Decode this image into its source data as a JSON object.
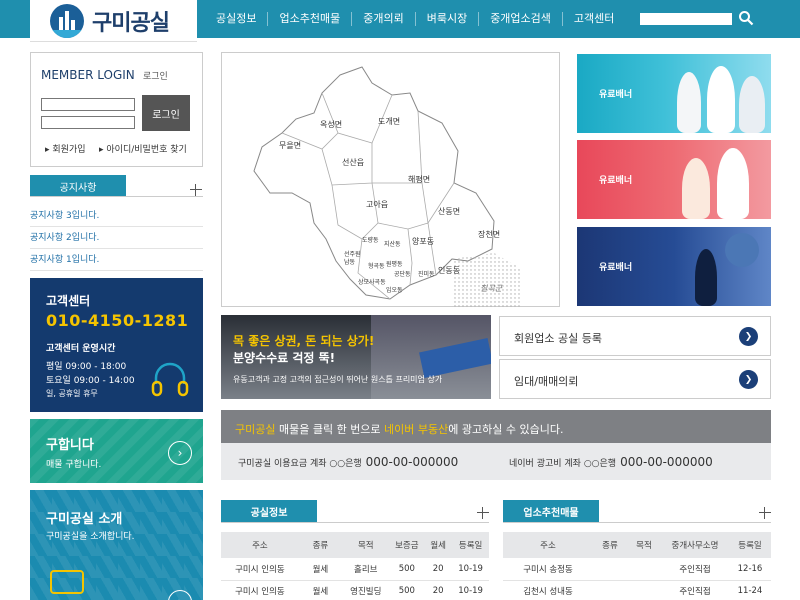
{
  "header": {
    "logo_text": "구미공실",
    "nav": [
      "공실정보",
      "업소추천매물",
      "중개의뢰",
      "벼룩시장",
      "중개업소검색",
      "고객센터"
    ]
  },
  "login": {
    "title": "MEMBER LOGIN",
    "subtitle": "로그인",
    "button": "로그인",
    "join": "회원가입",
    "find": "아이디/비밀번호 찾기"
  },
  "notice": {
    "title": "공지사항",
    "items": [
      "공지사항 3입니다.",
      "공지사항 2입니다.",
      "공지사항 1입니다."
    ]
  },
  "customer_center": {
    "title": "고객센터",
    "phone": "010-4150-1281",
    "hours_title": "고객센터 운영시간",
    "weekday": "평일 09:00 - 18:00",
    "saturday": "토요일 09:00 - 14:00",
    "holiday": "일, 공휴일 휴무"
  },
  "find_box": {
    "title": "구합니다",
    "subtitle": "매물 구합니다."
  },
  "intro_box": {
    "title": "구미공실 소개",
    "subtitle": "구미공실을 소개합니다."
  },
  "map": {
    "labels": [
      "옥성면",
      "도개면",
      "무을면",
      "선산읍",
      "해평면",
      "고아읍",
      "산동면",
      "장천면",
      "도량동",
      "지산동",
      "양포동",
      "선주원남동",
      "형곡동",
      "공단동",
      "진미동",
      "인동동",
      "상모사곡동",
      "임오동",
      "원평동",
      "칠곡군"
    ]
  },
  "banners": [
    {
      "label": "유료배너",
      "color": "#1fa4c8"
    },
    {
      "label": "유료배너",
      "color": "#e8505b"
    },
    {
      "label": "유료배너",
      "color": "#1c3f7e"
    }
  ],
  "promo": {
    "title": "목 좋은 상권, 돈 되는 상가!",
    "title2": "분양수수료 걱정 뚝!",
    "subtitle": "유동고객과 고정 고객의 접근성이 뛰어난 원스톱 프리미엄 상가"
  },
  "actions": [
    "회원업소 공실 등록",
    "임대/매매의뢰"
  ],
  "ad": {
    "headline_pre": "구미공실",
    "headline_mid": " 매물을 클릭 한 번으로 ",
    "headline_hl": "네이버 부동산",
    "headline_post": "에 광고하실 수 있습니다.",
    "acct1_label": "구미공실 이용요금 계좌  ○○은행",
    "acct1_num": "000-00-000000",
    "acct2_label": "네이버 광고비 계좌  ○○은행",
    "acct2_num": "000-00-000000"
  },
  "vacancy_table": {
    "title": "공실정보",
    "headers": [
      "주소",
      "종류",
      "목적",
      "보증금",
      "월세",
      "등록일"
    ],
    "rows": [
      [
        "구미시 인의동",
        "월세",
        "홀리브",
        "500",
        "20",
        "10-19"
      ],
      [
        "구미시 인의동",
        "월세",
        "영진빌딩",
        "500",
        "20",
        "10-19"
      ]
    ]
  },
  "recommend_table": {
    "title": "업소추천매물",
    "headers": [
      "주소",
      "종류",
      "목적",
      "중개사무소명",
      "등록일"
    ],
    "rows": [
      [
        "구미시 송정동",
        "",
        "",
        "주인직접",
        "12-16"
      ],
      [
        "김천시 성내동",
        "",
        "",
        "주인직접",
        "11-24"
      ]
    ]
  }
}
